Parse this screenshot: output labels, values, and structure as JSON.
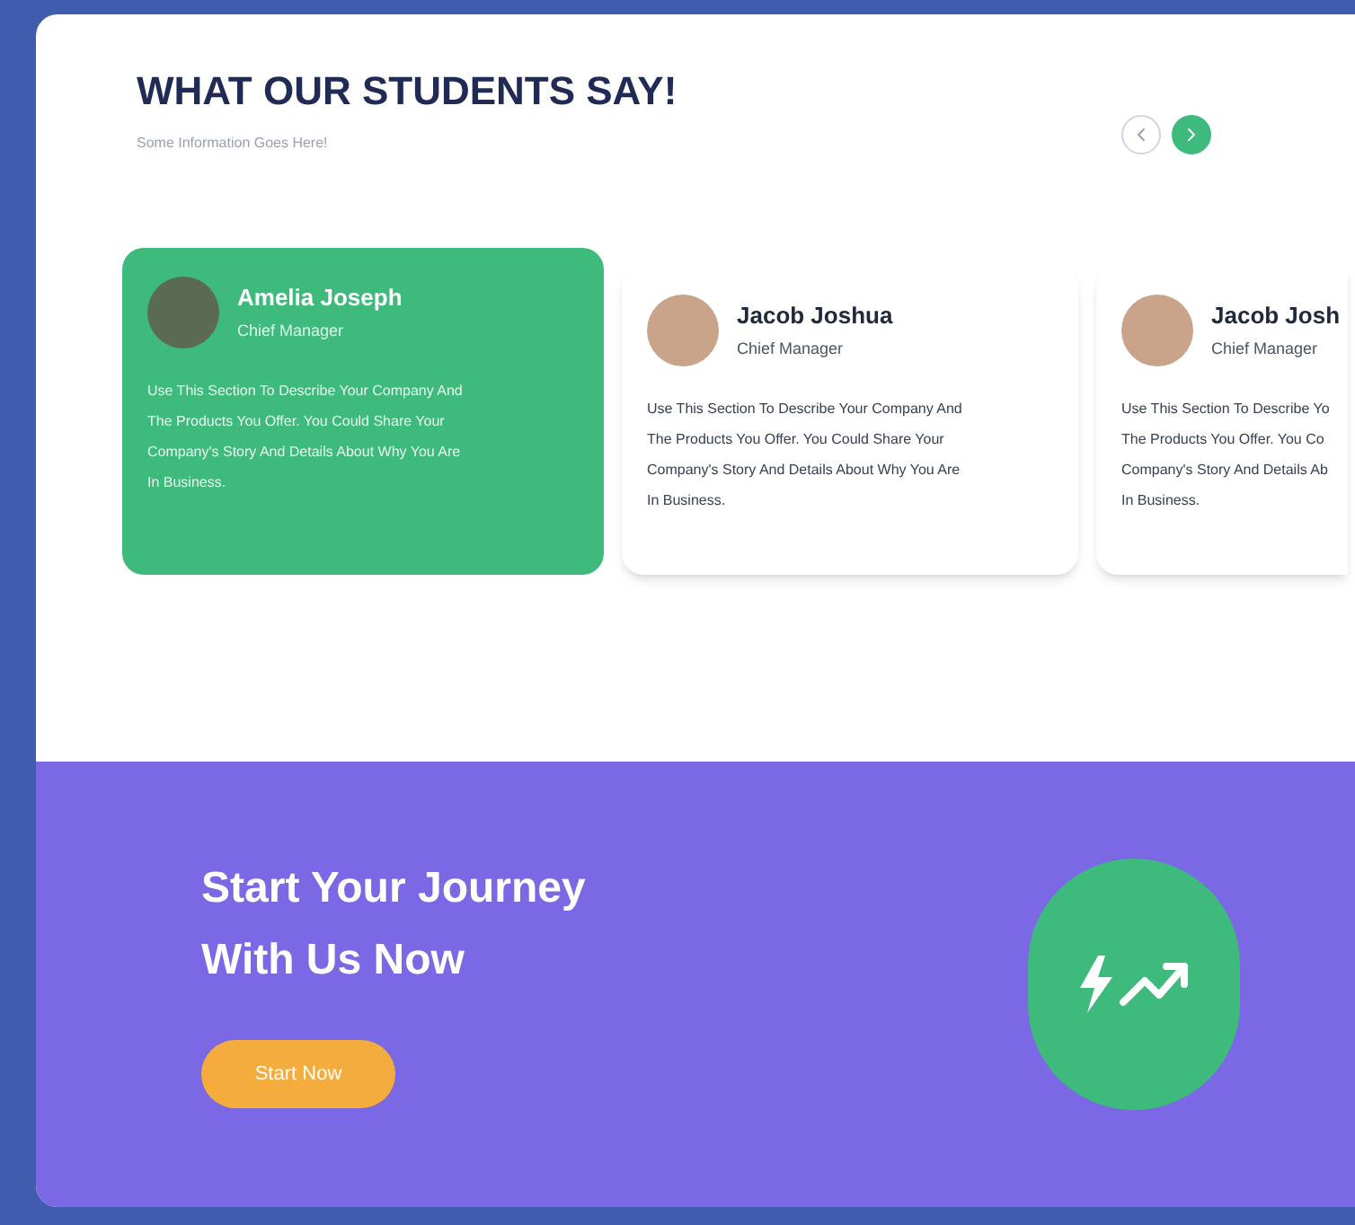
{
  "header": {
    "title": "WHAT OUR STUDENTS SAY!",
    "subtitle": "Some Information Goes Here!"
  },
  "nav_buttons": [
    {
      "kind": "prev",
      "selected": false
    },
    {
      "kind": "next",
      "selected": true
    }
  ],
  "testimonials": [
    {
      "name": "Amelia Joseph",
      "role": "Chief Manager",
      "selected": true,
      "description_lines": [
        "Use This Section To Describe Your Company And",
        "The Products You Offer. You Could Share Your",
        "Company's Story And Details About Why You Are",
        "In Business."
      ]
    },
    {
      "name": "Jacob Joshua",
      "role": "Chief Manager",
      "selected": false,
      "description_lines": [
        "Use This Section To Describe Your Company And",
        "The Products You Offer. You Could Share Your",
        "Company's Story And Details About Why You Are",
        "In Business."
      ]
    },
    {
      "name": "Jacob Josh",
      "role": "Chief Manager",
      "selected": false,
      "description_lines": [
        "Use This Section To Describe Yo",
        "The Products You Offer. You Co",
        "Company's Story And Details Ab",
        "In Business."
      ]
    }
  ],
  "cta": {
    "title_lines": [
      "Start Your Journey",
      "With Us Now"
    ],
    "button": "Start Now"
  }
}
